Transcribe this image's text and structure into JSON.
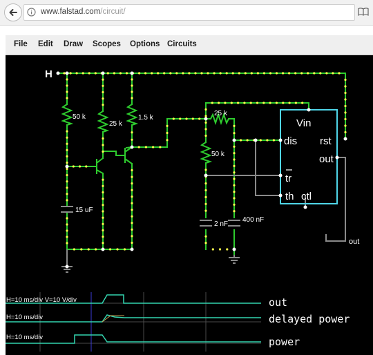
{
  "browser": {
    "url_host": "www.falstad.com",
    "url_path": "/circuit/"
  },
  "menu": {
    "items": [
      "File",
      "Edit",
      "Draw",
      "Scopes",
      "Options",
      "Circuits"
    ]
  },
  "circuit": {
    "node_label_h": "H",
    "r1": "50 k",
    "r2": "25 k",
    "r3": "1.5 k",
    "c1": "15 uF",
    "r4": "25 k",
    "r5": "50 k",
    "c2": "2 nF",
    "c3": "400 nF",
    "timer": {
      "vin": "Vin",
      "dis": "dis",
      "rst": "rst",
      "out": "out",
      "tr": "tr",
      "th": "th",
      "ctl": "ctl"
    },
    "output_label": "out"
  },
  "scopes": [
    {
      "info": "H=10 ms/div V=10 V/div",
      "label": "out"
    },
    {
      "info": "H=10 ms/div",
      "label": "delayed power"
    },
    {
      "info": "H=10 ms/div",
      "label": "power"
    }
  ],
  "colors": {
    "wire_live": "#2ecc2e",
    "wire_idle": "#8a8a8a",
    "current_dot": "#ffff4d",
    "chip_outline": "#4fd6e8",
    "scope_trace": "#33d6b0",
    "label": "#ffffff"
  }
}
